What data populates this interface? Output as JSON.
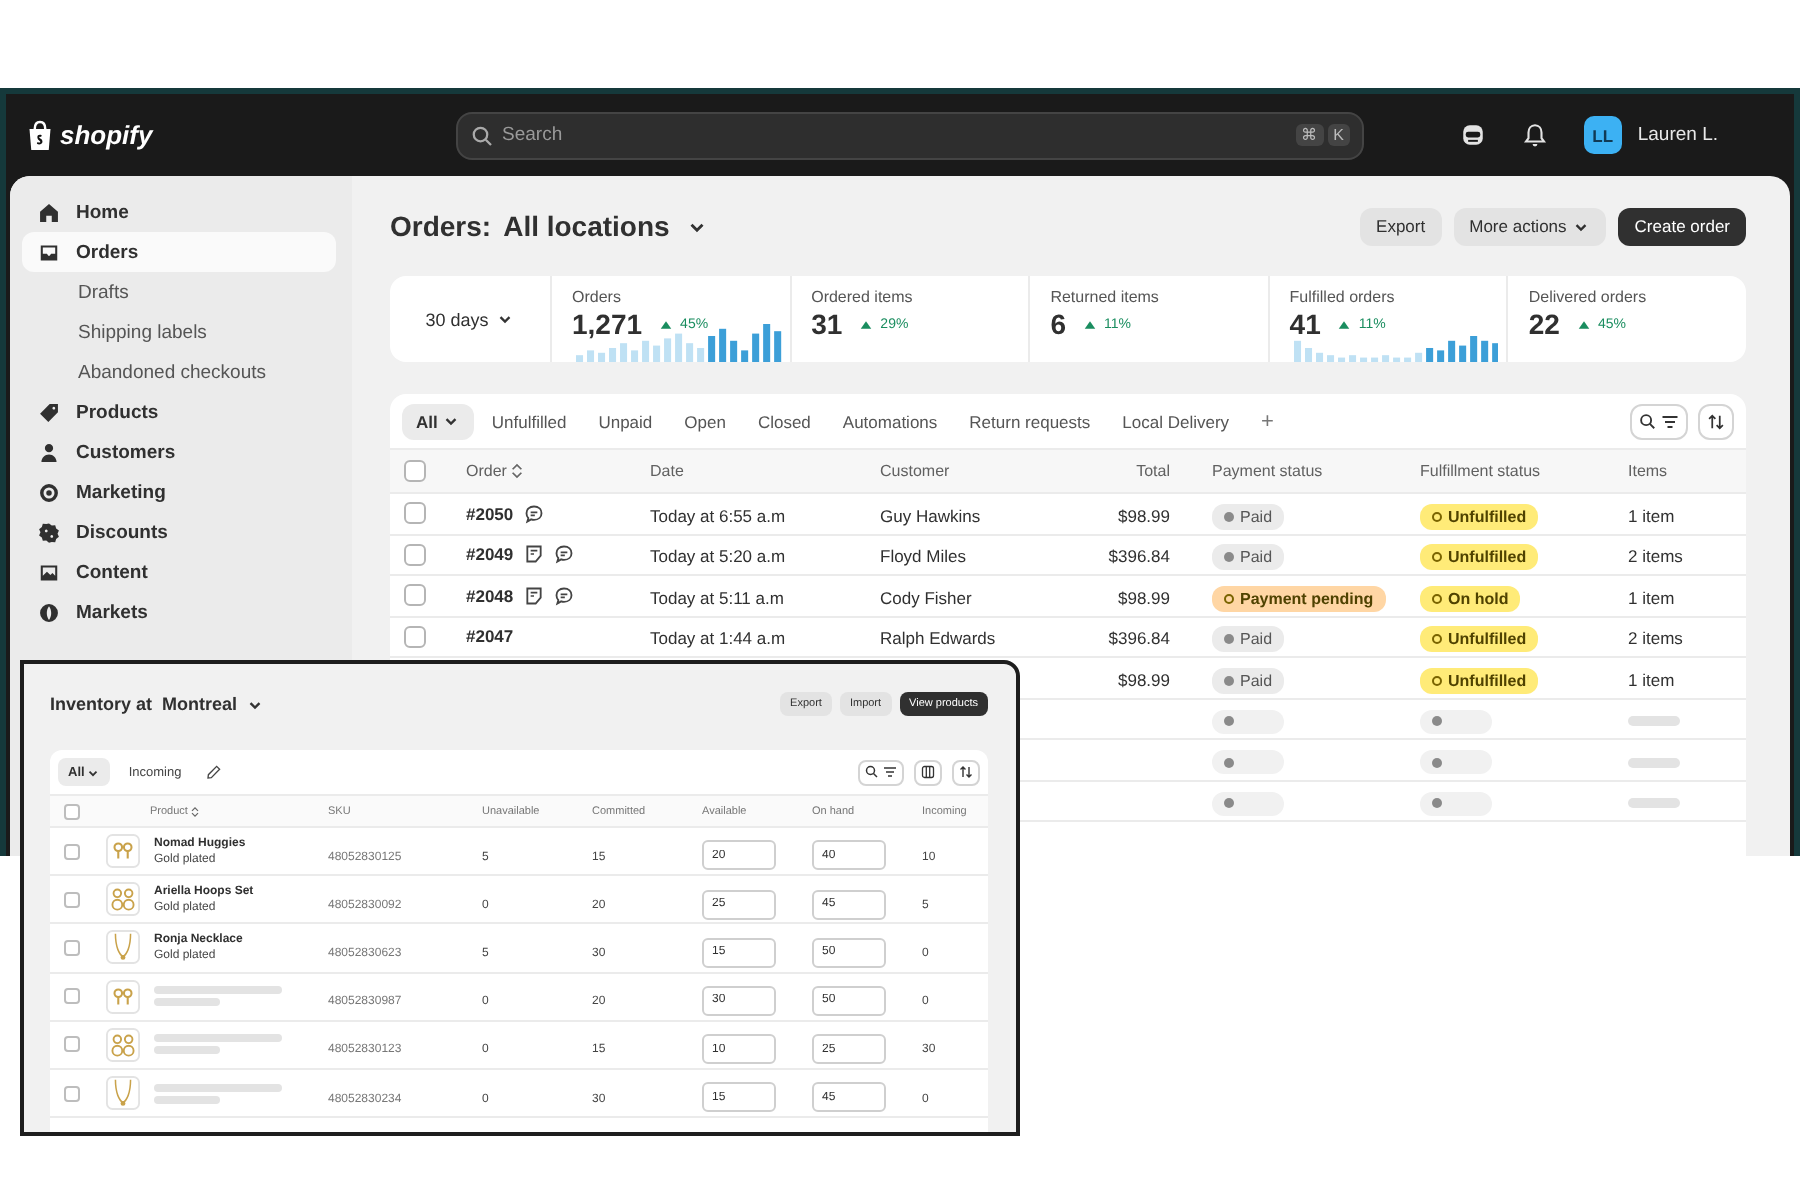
{
  "topbar": {
    "brand": "shopify",
    "search": {
      "placeholder": "Search",
      "shortcut": [
        "⌘",
        "K"
      ]
    },
    "avatar": "LL",
    "user": "Lauren L."
  },
  "sidebar": {
    "items": [
      {
        "label": "Home",
        "selected": false
      },
      {
        "label": "Orders",
        "selected": true,
        "children": [
          {
            "label": "Drafts",
            "selected": false
          },
          {
            "label": "Shipping labels",
            "selected": false
          },
          {
            "label": "Abandoned checkouts",
            "selected": false
          }
        ]
      },
      {
        "label": "Products",
        "selected": false
      },
      {
        "label": "Customers",
        "selected": false
      },
      {
        "label": "Marketing",
        "selected": false
      },
      {
        "label": "Discounts",
        "selected": false
      },
      {
        "label": "Content",
        "selected": false
      },
      {
        "label": "Markets",
        "selected": false
      }
    ]
  },
  "orders": {
    "title": "Orders:",
    "location": "All locations",
    "buttons": [
      {
        "label": "Export",
        "primary": false,
        "dropdown": false
      },
      {
        "label": "More actions",
        "primary": false,
        "dropdown": true
      },
      {
        "label": "Create order",
        "primary": true,
        "dropdown": false
      }
    ],
    "period": "30 days",
    "stats": [
      {
        "label": "Orders",
        "value": "1,271",
        "change": "45%",
        "sparkline": true
      },
      {
        "label": "Ordered items",
        "value": "31",
        "change": "29%",
        "sparkline": false
      },
      {
        "label": "Returned items",
        "value": "6",
        "change": "11%",
        "sparkline": false
      },
      {
        "label": "Fulfilled orders",
        "value": "41",
        "change": "11%",
        "sparkline": true
      },
      {
        "label": "Delivered orders",
        "value": "22",
        "change": "45%",
        "sparkline": false
      }
    ],
    "tabs": [
      {
        "label": "All",
        "selected": true,
        "dropdown": true
      },
      {
        "label": "Unfulfilled",
        "selected": false,
        "dropdown": false
      },
      {
        "label": "Unpaid",
        "selected": false,
        "dropdown": false
      },
      {
        "label": "Open",
        "selected": false,
        "dropdown": false
      },
      {
        "label": "Closed",
        "selected": false,
        "dropdown": false
      },
      {
        "label": "Automations",
        "selected": false,
        "dropdown": false
      },
      {
        "label": "Return requests",
        "selected": false,
        "dropdown": false
      },
      {
        "label": "Local Delivery",
        "selected": false,
        "dropdown": false
      }
    ],
    "add_tab": "+",
    "table": {
      "select_all_checked": false,
      "columns": [
        "Order",
        "Date",
        "Customer",
        "Total",
        "Payment status",
        "Fulfillment status",
        "Items"
      ],
      "rows": [
        {
          "kind": "order",
          "checked": false,
          "order": "#2050",
          "has_note": false,
          "has_comment": true,
          "date": "Today at 6:55 a.m",
          "customer": "Guy Hawkins",
          "total": "$98.99",
          "payment": {
            "label": "Paid",
            "kind": "complete",
            "color": "#ebebeb"
          },
          "fulfillment": {
            "label": "Unfulfilled",
            "kind": "incomplete",
            "color": "#ffeb78"
          },
          "items": "1 item"
        },
        {
          "kind": "order",
          "checked": false,
          "order": "#2049",
          "has_note": true,
          "has_comment": true,
          "date": "Today at 5:20 a.m",
          "customer": "Floyd Miles",
          "total": "$396.84",
          "payment": {
            "label": "Paid",
            "kind": "complete",
            "color": "#ebebeb"
          },
          "fulfillment": {
            "label": "Unfulfilled",
            "kind": "incomplete",
            "color": "#ffeb78"
          },
          "items": "2 items"
        },
        {
          "kind": "order",
          "checked": false,
          "order": "#2048",
          "has_note": true,
          "has_comment": true,
          "date": "Today at 5:11 a.m",
          "customer": "Cody Fisher",
          "total": "$98.99",
          "payment": {
            "label": "Payment pending",
            "kind": "incomplete",
            "color": "#ffd6a4"
          },
          "fulfillment": {
            "label": "On hold",
            "kind": "incomplete",
            "color": "#ffeb78"
          },
          "items": "1 item"
        },
        {
          "kind": "order",
          "checked": false,
          "order": "#2047",
          "has_note": false,
          "has_comment": false,
          "date": "Today at 1:44 a.m",
          "customer": "Ralph Edwards",
          "total": "$396.84",
          "payment": {
            "label": "Paid",
            "kind": "complete",
            "color": "#ebebeb"
          },
          "fulfillment": {
            "label": "Unfulfilled",
            "kind": "incomplete",
            "color": "#ffeb78"
          },
          "items": "2 items"
        },
        {
          "kind": "order",
          "total": "$98.99",
          "payment": {
            "label": "Paid",
            "kind": "complete",
            "color": "#ebebeb"
          },
          "fulfillment": {
            "label": "Unfulfilled",
            "kind": "incomplete",
            "color": "#ffeb78"
          },
          "items": "1 item"
        },
        {
          "kind": "skeleton"
        },
        {
          "kind": "skeleton"
        },
        {
          "kind": "skeleton"
        }
      ]
    }
  },
  "inventory": {
    "title": "Inventory at  Montreal",
    "buttons": [
      {
        "label": "Export",
        "primary": false
      },
      {
        "label": "Import",
        "primary": false
      },
      {
        "label": "View products",
        "primary": true
      }
    ],
    "tabs": [
      {
        "label": "All",
        "selected": true,
        "dropdown": true
      },
      {
        "label": "Incoming",
        "selected": false,
        "dropdown": false
      }
    ],
    "select_all_checked": false,
    "columns": [
      "Product",
      "SKU",
      "Unavailable",
      "Committed",
      "Available",
      "On hand",
      "Incoming"
    ],
    "rows": [
      {
        "kind": "product",
        "checked": false,
        "name": "Nomad Huggies",
        "variant": "Gold plated",
        "sku": "48052830125",
        "unavailable": "5",
        "committed": "15",
        "available": "20",
        "on_hand": "40",
        "incoming": "10"
      },
      {
        "kind": "product",
        "checked": false,
        "name": "Ariella Hoops Set",
        "variant": "Gold plated",
        "sku": "48052830092",
        "unavailable": "0",
        "committed": "20",
        "available": "25",
        "on_hand": "45",
        "incoming": "5"
      },
      {
        "kind": "product",
        "checked": false,
        "name": "Ronja Necklace",
        "variant": "Gold plated",
        "sku": "48052830623",
        "unavailable": "5",
        "committed": "30",
        "available": "15",
        "on_hand": "50",
        "incoming": "0"
      },
      {
        "kind": "skeleton",
        "checked": false,
        "sku": "48052830987",
        "unavailable": "0",
        "committed": "20",
        "available": "30",
        "on_hand": "50",
        "incoming": "0"
      },
      {
        "kind": "skeleton",
        "checked": false,
        "sku": "48052830123",
        "unavailable": "0",
        "committed": "15",
        "available": "10",
        "on_hand": "25",
        "incoming": "30"
      },
      {
        "kind": "skeleton",
        "checked": false,
        "sku": "48052830234",
        "unavailable": "0",
        "committed": "30",
        "available": "15",
        "on_hand": "45",
        "incoming": "0"
      }
    ]
  }
}
